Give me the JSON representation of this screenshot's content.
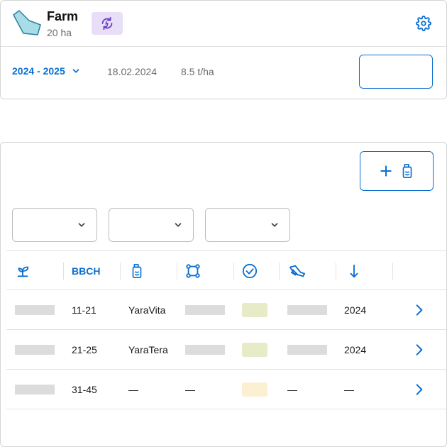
{
  "field": {
    "name": "Farm",
    "area": "20 ha",
    "season": "2024 - 2025",
    "date": "18.02.2024",
    "yield": "8.5 t/ha"
  },
  "table": {
    "header": {
      "bbch": "BBCH"
    },
    "rows": [
      {
        "bbch": "11-21",
        "product": "YaraVita",
        "year": "2024",
        "status_color": "#e8ebc8",
        "placeholders": {
          "crop": true,
          "area": true,
          "method": true
        }
      },
      {
        "bbch": "21-25",
        "product": "YaraTera",
        "year": "2024",
        "status_color": "#e8ebc8",
        "placeholders": {
          "crop": true,
          "area": true,
          "method": true
        }
      },
      {
        "bbch": "31-45",
        "product": "—",
        "area_text": "—",
        "method_text": "—",
        "year": "—",
        "status_color": "#fbf0d2",
        "placeholders": {
          "crop": true,
          "area": false,
          "method": false
        }
      }
    ]
  },
  "colors": {
    "accent": "#0b6fd0",
    "badge_bg": "#e8def8",
    "badge_icon": "#6a3fc8",
    "field_fill": "#a8dde8",
    "field_stroke": "#2b7fa0"
  },
  "icons": {
    "field": "field-shape-icon",
    "sync": "sync-icon",
    "settings": "gear-icon",
    "season_toggle": "chevron-down-icon",
    "add": "plus-icon",
    "product": "fertilizer-bottle-icon",
    "crop": "seedling-icon",
    "area": "polygon-area-icon",
    "status": "check-circle-icon",
    "method": "tractor-spreader-icon",
    "sort": "arrow-down-icon",
    "row_open": "chevron-right-icon"
  }
}
